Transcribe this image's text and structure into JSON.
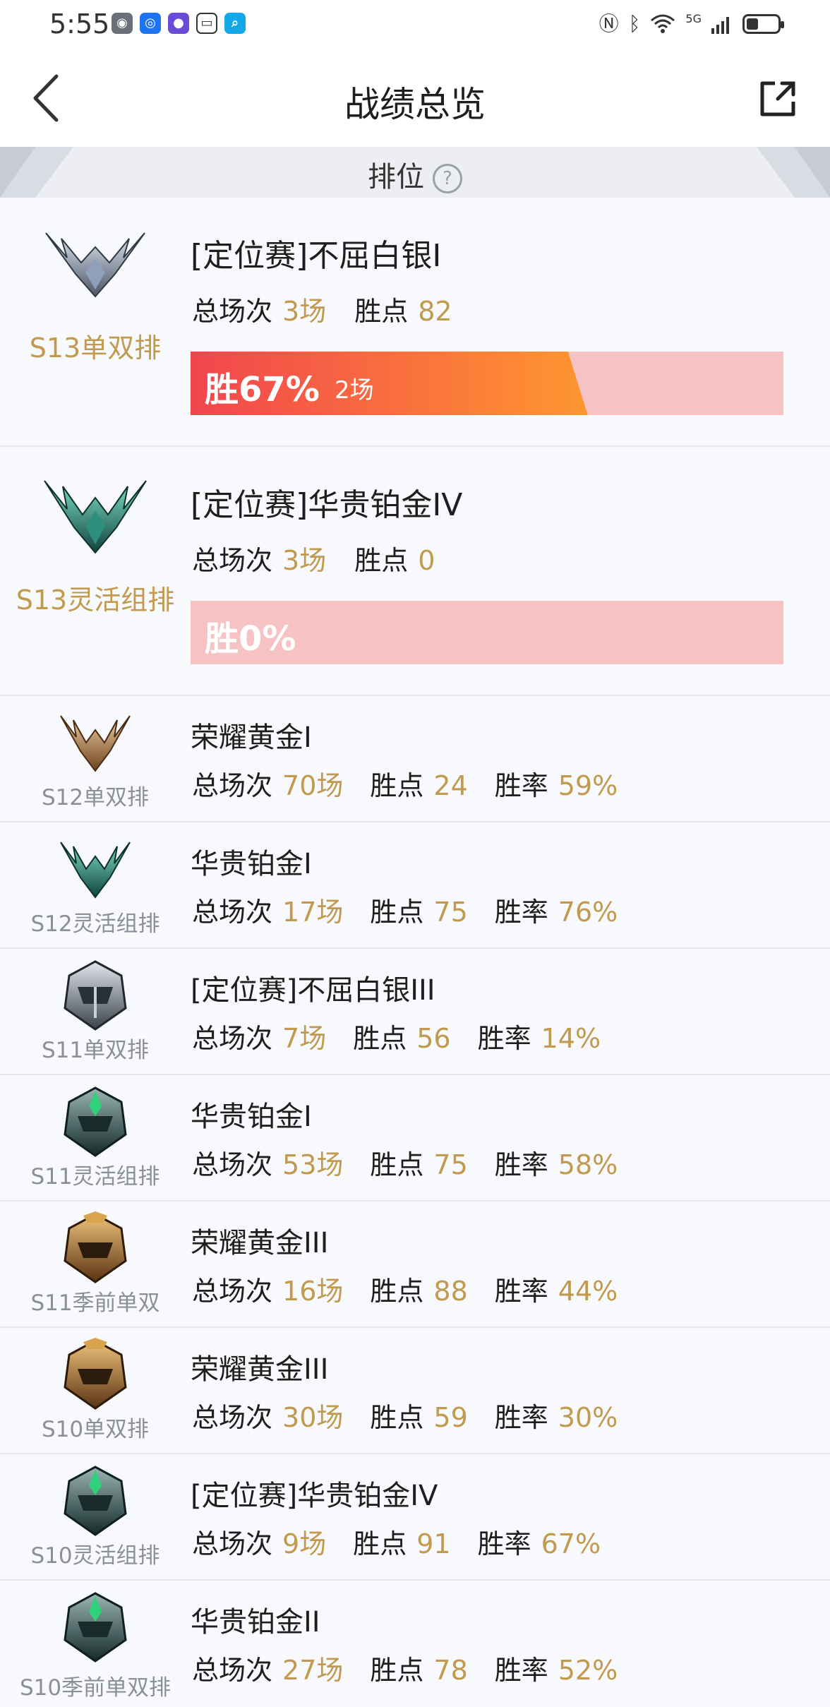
{
  "status_bar": {
    "time": "5:55",
    "network": "5G"
  },
  "nav": {
    "title": "战绩总览"
  },
  "section": {
    "title": "排位",
    "help": "?"
  },
  "big_cards": [
    {
      "season": "S13单双排",
      "rank": "[定位赛]不屈白银I",
      "games_label": "总场次",
      "games": "3场",
      "points_label": "胜点",
      "points": "82",
      "win_label": "胜67%",
      "win_count": "2场",
      "win_rate": 0.67,
      "badge_color": "silver"
    },
    {
      "season": "S13灵活组排",
      "rank": "[定位赛]华贵铂金IV",
      "games_label": "总场次",
      "games": "3场",
      "points_label": "胜点",
      "points": "0",
      "win_label": "胜0%",
      "win_count": "",
      "win_rate": 0.0,
      "badge_color": "teal"
    }
  ],
  "rows": [
    {
      "season": "S12单双排",
      "rank": "荣耀黄金I",
      "games": "70场",
      "points": "24",
      "rate": "59%",
      "badge": "gold-wings"
    },
    {
      "season": "S12灵活组排",
      "rank": "华贵铂金I",
      "games": "17场",
      "points": "75",
      "rate": "76%",
      "badge": "teal-wings"
    },
    {
      "season": "S11单双排",
      "rank": "[定位赛]不屈白银III",
      "games": "7场",
      "points": "56",
      "rate": "14%",
      "badge": "silver-helm"
    },
    {
      "season": "S11灵活组排",
      "rank": "华贵铂金I",
      "games": "53场",
      "points": "75",
      "rate": "58%",
      "badge": "teal-helm"
    },
    {
      "season": "S11季前单双",
      "rank": "荣耀黄金III",
      "games": "16场",
      "points": "88",
      "rate": "44%",
      "badge": "gold-helm"
    },
    {
      "season": "S10单双排",
      "rank": "荣耀黄金III",
      "games": "30场",
      "points": "59",
      "rate": "30%",
      "badge": "gold-helm"
    },
    {
      "season": "S10灵活组排",
      "rank": "[定位赛]华贵铂金IV",
      "games": "9场",
      "points": "91",
      "rate": "67%",
      "badge": "teal-helm"
    },
    {
      "season": "S10季前单双排",
      "rank": "华贵铂金II",
      "games": "27场",
      "points": "78",
      "rate": "52%",
      "badge": "teal-helm"
    }
  ],
  "labels": {
    "games": "总场次",
    "points": "胜点",
    "rate": "胜率"
  },
  "colors": {
    "accent_gold": "#c19a4f",
    "win_bar_from": "#f2454e",
    "win_bar_to": "#ff9630",
    "win_bar_bg": "#f7c2c4"
  }
}
